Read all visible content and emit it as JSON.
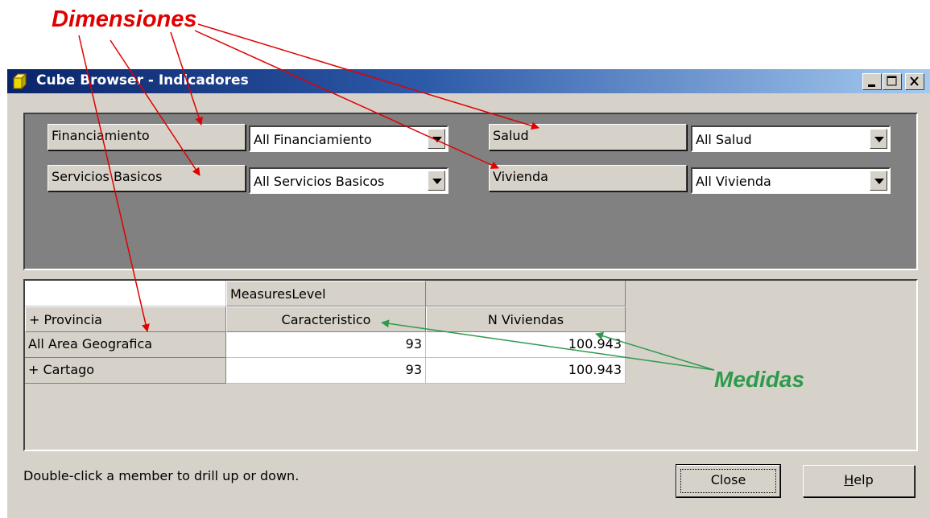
{
  "annotations": {
    "dimensions_label": "Dimensiones",
    "measures_label": "Medidas",
    "dimensions_color": "#e00000",
    "measures_color": "#2e9a4c"
  },
  "window": {
    "title": "Cube Browser - Indicadores",
    "title_icon": "cube-icon",
    "controls": [
      "minimize-icon",
      "maximize-icon",
      "close-icon"
    ]
  },
  "filters": [
    {
      "dimension": "Financiamiento",
      "selected": "All Financiamiento"
    },
    {
      "dimension": "Servicios Basicos",
      "selected": "All Servicios Basicos"
    },
    {
      "dimension": "Salud",
      "selected": "All Salud"
    },
    {
      "dimension": "Vivienda",
      "selected": "All Vivienda"
    }
  ],
  "grid": {
    "column_dimension": "MeasuresLevel",
    "row_dimension": "+ Provincia",
    "columns": [
      "Caracteristico",
      "N Viviendas"
    ],
    "rows": [
      {
        "label": "All Area Geografica",
        "values": [
          "93",
          "100.943"
        ]
      },
      {
        "label": "+  Cartago",
        "values": [
          "93",
          "100.943"
        ]
      }
    ]
  },
  "status": "Double-click a member to drill up or down.",
  "buttons": {
    "close": "Close",
    "help_prefix": "H",
    "help_rest": "elp"
  }
}
